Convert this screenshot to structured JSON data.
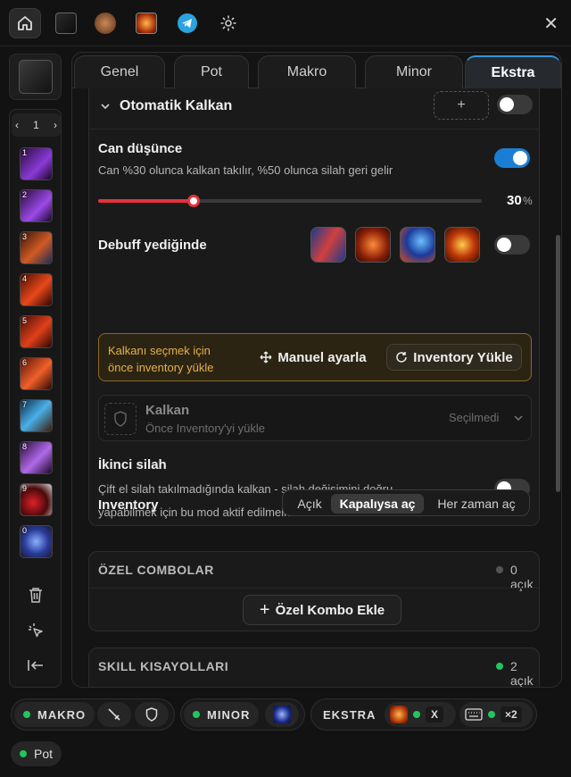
{
  "topbar": {
    "icons": [
      "home-icon",
      "slash-skill-icon",
      "warrior-avatar-icon",
      "fire-skill-icon",
      "telegram-icon",
      "gear-icon"
    ],
    "close": "✕"
  },
  "sidebar": {
    "page": "1",
    "slots": [
      "1",
      "2",
      "3",
      "4",
      "5",
      "6",
      "7",
      "8",
      "9",
      "0"
    ]
  },
  "tabs": [
    "Genel",
    "Pot",
    "Makro",
    "Minor",
    "Ekstra"
  ],
  "active_tab": "Ekstra",
  "auto_shield": {
    "title": "Otomatik Kalkan",
    "add_label": "+",
    "enabled": false,
    "hp_title": "Can düşünce",
    "hp_desc": "Can %30 olunca kalkan takılır, %50 olunca silah geri gelir",
    "hp_enabled": true,
    "hp_value": "30",
    "hp_unit": "%",
    "hp_fraction": 0.3,
    "debuff_title": "Debuff yediğinde",
    "debuff_enabled": false,
    "warn_text_1": "Kalkanı seçmek için",
    "warn_text_2": "önce inventory yükle",
    "manual_btn": "Manuel ayarla",
    "inv_btn": "Inventory Yükle",
    "shield_title": "Kalkan",
    "shield_sub": "Önce Inventory'yi yükle",
    "shield_select": "Seçilmedi",
    "second_weapon_title": "İkinci silah",
    "second_weapon_desc_1": "Çift el silah takılmadığında kalkan - silah değişimini doğru",
    "second_weapon_desc_2": "yapabilmek için bu mod aktif edilmelidir",
    "second_weapon_enabled": false,
    "inventory_label": "Inventory",
    "inventory_options": [
      "Açık",
      "Kapalıysa aç",
      "Her zaman aç"
    ],
    "inventory_selected": "Kapalıysa aç"
  },
  "combos": {
    "title": "ÖZEL COMBOLAR",
    "count": "0 açık",
    "add_btn": "Özel Kombo Ekle"
  },
  "skills": {
    "title": "SKILL KISAYOLLARI",
    "count": "2 açık"
  },
  "bottom": {
    "makro": "MAKRO",
    "minor": "MINOR",
    "ekstra": "EKSTRA",
    "x_label": "X",
    "multiplier": "×2",
    "pot": "Pot"
  },
  "colors": {
    "accent": "#2f96d8",
    "slider": "#e5323b",
    "active_dot": "#22c55e",
    "warn_border": "#8a6a25"
  }
}
